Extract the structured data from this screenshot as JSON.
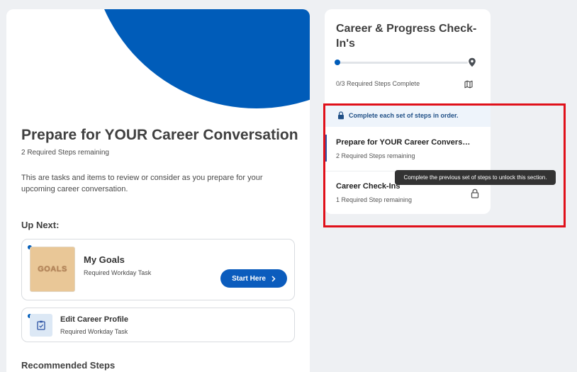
{
  "main": {
    "title": "Prepare for YOUR Career Conversation",
    "subtitle": "2 Required Steps remaining",
    "description": "This are tasks and items to review or consider as you prepare for your upcoming career conversation.",
    "up_next_heading": "Up Next:",
    "recommended_heading": "Recommended Steps",
    "tasks": [
      {
        "title": "My Goals",
        "subtitle": "Required Workday Task",
        "thumbnail_text": "GOALS",
        "button_label": "Start Here"
      },
      {
        "title": "Edit Career Profile",
        "subtitle": "Required Workday Task",
        "icon": "clipboard-icon"
      }
    ]
  },
  "progress": {
    "title": "Career & Progress Check-In's",
    "steps_complete": "0/3 Required Steps Complete",
    "order_notice": "Complete each set of steps in order.",
    "items": [
      {
        "title": "Prepare for YOUR Career Conversation",
        "subtitle": "2 Required Steps remaining",
        "state": "current"
      },
      {
        "title": "Career Check-Ins",
        "subtitle": "1 Required Step remaining",
        "state": "locked"
      }
    ]
  },
  "tooltip": {
    "text": "Complete the previous set of steps to unlock this section."
  },
  "colors": {
    "brand_blue": "#005cb9",
    "button_blue": "#0b5cbd",
    "highlight_red": "#e0101a",
    "tooltip_bg": "#333333"
  }
}
